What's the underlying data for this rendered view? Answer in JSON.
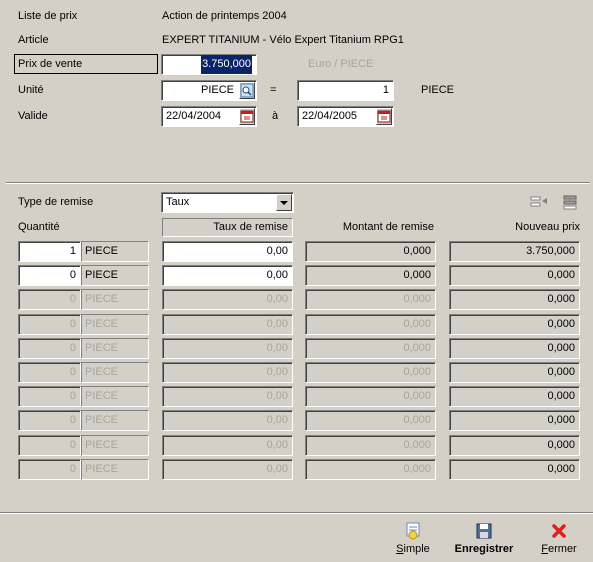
{
  "header": {
    "price_list_label": "Liste de prix",
    "price_list_value": "Action de printemps 2004",
    "article_label": "Article",
    "article_value": "EXPERT TITANIUM - Vélo Expert Titanium RPG1",
    "sale_price_label": "Prix de vente",
    "sale_price_value": "3.750,000",
    "currency_unit_label": "Euro / PIECE",
    "unit_label": "Unité",
    "unit_value": "PIECE",
    "equals": "=",
    "unit_qty": "1",
    "unit_after": "PIECE",
    "valid_label": "Valide",
    "valid_from": "22/04/2004",
    "valid_to_label": "à",
    "valid_to": "22/04/2005"
  },
  "discount": {
    "type_label": "Type de remise",
    "type_value": "Taux",
    "col_qty": "Quantité",
    "col_rate": "Taux de remise",
    "col_amount": "Montant de remise",
    "col_new_price": "Nouveau prix"
  },
  "rows": [
    {
      "qty": "1",
      "unit": "PIECE",
      "rate": "0,00",
      "amount": "0,000",
      "price": "3.750,000"
    },
    {
      "qty": "0",
      "unit": "PIECE",
      "rate": "0,00",
      "amount": "0,000",
      "price": "0,000"
    },
    {
      "qty": "0",
      "unit": "PIECE",
      "rate": "0,00",
      "amount": "0,000",
      "price": "0,000"
    },
    {
      "qty": "0",
      "unit": "PIECE",
      "rate": "0,00",
      "amount": "0,000",
      "price": "0,000"
    },
    {
      "qty": "0",
      "unit": "PIECE",
      "rate": "0,00",
      "amount": "0,000",
      "price": "0,000"
    },
    {
      "qty": "0",
      "unit": "PIECE",
      "rate": "0,00",
      "amount": "0,000",
      "price": "0,000"
    },
    {
      "qty": "0",
      "unit": "PIECE",
      "rate": "0,00",
      "amount": "0,000",
      "price": "0,000"
    },
    {
      "qty": "0",
      "unit": "PIECE",
      "rate": "0,00",
      "amount": "0,000",
      "price": "0,000"
    },
    {
      "qty": "0",
      "unit": "PIECE",
      "rate": "0,00",
      "amount": "0,000",
      "price": "0,000"
    },
    {
      "qty": "0",
      "unit": "PIECE",
      "rate": "0,00",
      "amount": "0,000",
      "price": "0,000"
    }
  ],
  "footer": {
    "simple_label": "Simple",
    "save_label": "Enregistrer",
    "close_label": "Fermer"
  },
  "icons": {
    "unit_lookup": "lookup-icon",
    "date_picker": "calendar-icon",
    "insert_row": "insert-row-icon",
    "delete_row": "delete-row-icon",
    "simple": "simple-icon",
    "save": "save-icon",
    "close": "close-icon"
  },
  "colors": {
    "background": "#d4d0c8",
    "selection": "#0a246a",
    "close_icon": "#e0201a"
  }
}
